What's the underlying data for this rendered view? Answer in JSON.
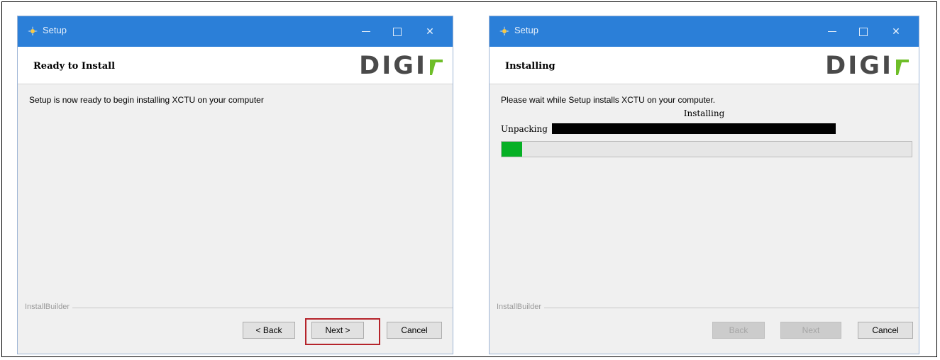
{
  "window_left": {
    "title": "Setup",
    "header_title": "Ready to Install",
    "logo_text": "DIGI",
    "body_text": "Setup is now ready to begin installing XCTU on your computer",
    "footer_label": "InstallBuilder",
    "buttons": {
      "back": "< Back",
      "next": "Next >",
      "cancel": "Cancel"
    }
  },
  "window_right": {
    "title": "Setup",
    "header_title": "Installing",
    "logo_text": "DIGI",
    "body_text": "Please wait while Setup installs XCTU on your computer.",
    "status_text": "Installing",
    "unpack_label": "Unpacking",
    "progress": 0.05,
    "footer_label": "InstallBuilder",
    "buttons": {
      "back": "Back",
      "next": "Next",
      "cancel": "Cancel"
    }
  },
  "colors": {
    "titlebar": "#2b7fd8",
    "progress_fill": "#06b025",
    "highlight": "#b5242b",
    "logo_accent": "#6ebe28"
  },
  "icons": [
    "setup-app-icon",
    "minimize-icon",
    "maximize-icon",
    "close-icon"
  ]
}
